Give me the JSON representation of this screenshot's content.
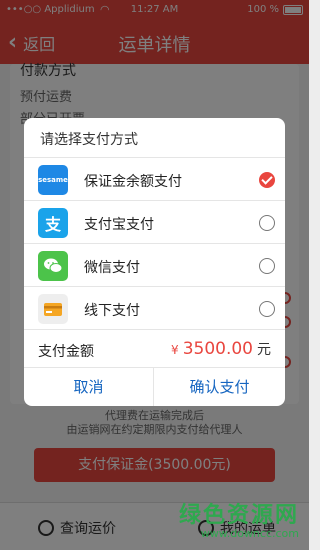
{
  "status_bar": {
    "carrier": "•••○○ Applidium",
    "wifi": "wifi",
    "time": "11:27 AM",
    "battery": "100 %"
  },
  "nav": {
    "back_label": "返回",
    "title": "运单详情"
  },
  "page": {
    "payment_method_label": "付款方式",
    "prepaid_freight": "预付运费",
    "partial_hidden": "部分已开票",
    "notice_line1": "代理费在运输完成后",
    "notice_line2": "由运销网在约定期限内支付给代理人",
    "pay_deposit_button": "支付保证金(3500.00元)"
  },
  "bottom_bar": {
    "query_freight": "查询运价",
    "my_waybill": "我的运单"
  },
  "watermark": {
    "main": "绿色资源网",
    "sub": "www.downcc.com"
  },
  "dialog": {
    "title": "请选择支付方式",
    "options": [
      {
        "label": "保证金余额支付",
        "icon": "sesame-deposit-icon",
        "icon_text": "sesame",
        "color": "#1e88e5",
        "checked": true
      },
      {
        "label": "支付宝支付",
        "icon": "alipay-icon",
        "icon_text": "支",
        "color": "#1aa3ea",
        "checked": false
      },
      {
        "label": "微信支付",
        "icon": "wechat-icon",
        "icon_text": "",
        "color": "#4cc34a",
        "checked": false
      },
      {
        "label": "线下支付",
        "icon": "card-icon",
        "icon_text": "",
        "color": "#eeeeee",
        "checked": false
      }
    ],
    "amount_label": "支付金额",
    "currency_symbol": "¥",
    "amount_value": "3500.00",
    "amount_unit": "元",
    "cancel": "取消",
    "confirm": "确认支付"
  },
  "colors": {
    "accent": "#e9463f",
    "action_blue": "#1565c0"
  }
}
